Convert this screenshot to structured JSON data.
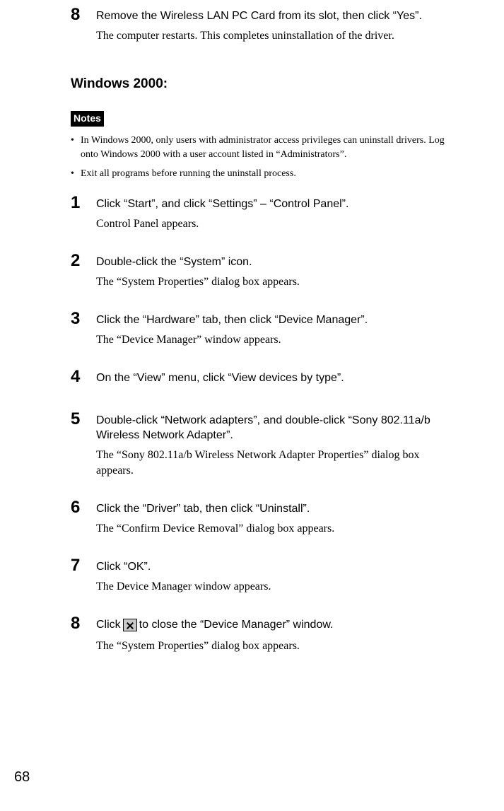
{
  "intro_step": {
    "num": "8",
    "action": "Remove the Wireless LAN PC Card from its slot, then click “Yes”.",
    "result": "The computer restarts. This completes uninstallation of the driver."
  },
  "heading": "Windows 2000:",
  "notes_label": "Notes",
  "notes": [
    "In Windows 2000, only users with administrator access privileges can uninstall drivers. Log onto Windows 2000 with a user account listed in “Administrators”.",
    "Exit all programs before running the uninstall process."
  ],
  "steps": [
    {
      "num": "1",
      "action": "Click “Start”, and click “Settings” – “Control Panel”.",
      "result": "Control Panel appears."
    },
    {
      "num": "2",
      "action": "Double-click the “System” icon.",
      "result": "The “System Properties” dialog box appears."
    },
    {
      "num": "3",
      "action": "Click the “Hardware” tab, then click “Device Manager”.",
      "result": "The “Device Manager” window appears."
    },
    {
      "num": "4",
      "action": "On the “View” menu, click “View devices by type”.",
      "result": ""
    },
    {
      "num": "5",
      "action": "Double-click “Network adapters”, and double-click “Sony 802.11a/b Wireless Network Adapter”.",
      "result": "The “Sony 802.11a/b Wireless Network Adapter Properties” dialog box appears."
    },
    {
      "num": "6",
      "action": "Click the “Driver” tab, then click “Uninstall”.",
      "result": "The “Confirm Device Removal” dialog box appears."
    },
    {
      "num": "7",
      "action": "Click “OK”.",
      "result": "The Device Manager window appears."
    },
    {
      "num": "8",
      "action_pre": "Click ",
      "action_post": " to close the “Device Manager” window.",
      "result": "The “System Properties” dialog box appears.",
      "has_icon": true
    }
  ],
  "page_number": "68"
}
